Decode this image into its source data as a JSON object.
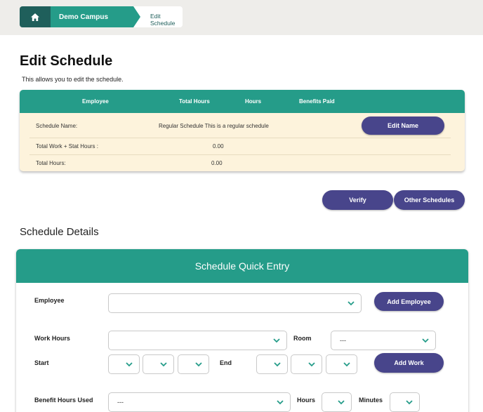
{
  "breadcrumb": {
    "home_icon": "home-icon",
    "campus": "Demo Campus",
    "current": "Edit Schedule"
  },
  "page": {
    "title": "Edit Schedule",
    "description": "This allows you to edit the schedule."
  },
  "summary": {
    "headers": [
      "Employee",
      "Total Hours",
      "Hours",
      "Benefits Paid"
    ],
    "schedule_name_label": "Schedule Name:",
    "schedule_name_value": "Regular Schedule This is a regular schedule",
    "edit_name_button": "Edit Name",
    "total_work_label": "Total Work + Stat Hours :",
    "total_work_value": "0.00",
    "total_hours_label": "Total Hours:",
    "total_hours_value": "0.00"
  },
  "actions": {
    "verify": "Verify",
    "other_schedules": "Other Schedules"
  },
  "details": {
    "section_title": "Schedule Details",
    "quick_entry_title": "Schedule Quick Entry",
    "employee_label": "Employee",
    "employee_value": "",
    "add_employee_button": "Add Employee",
    "work_hours_label": "Work Hours",
    "work_hours_value": "",
    "room_label": "Room",
    "room_value": "---",
    "start_label": "Start",
    "end_label": "End",
    "add_work_button": "Add Work",
    "benefit_label": "Benefit Hours Used",
    "benefit_value": "---",
    "hours_label": "Hours",
    "minutes_label": "Minutes"
  },
  "colors": {
    "teal": "#259c89",
    "dark_teal": "#1f5f5b",
    "button_purple": "#48458b",
    "summary_bg": "#fdf3dc"
  }
}
